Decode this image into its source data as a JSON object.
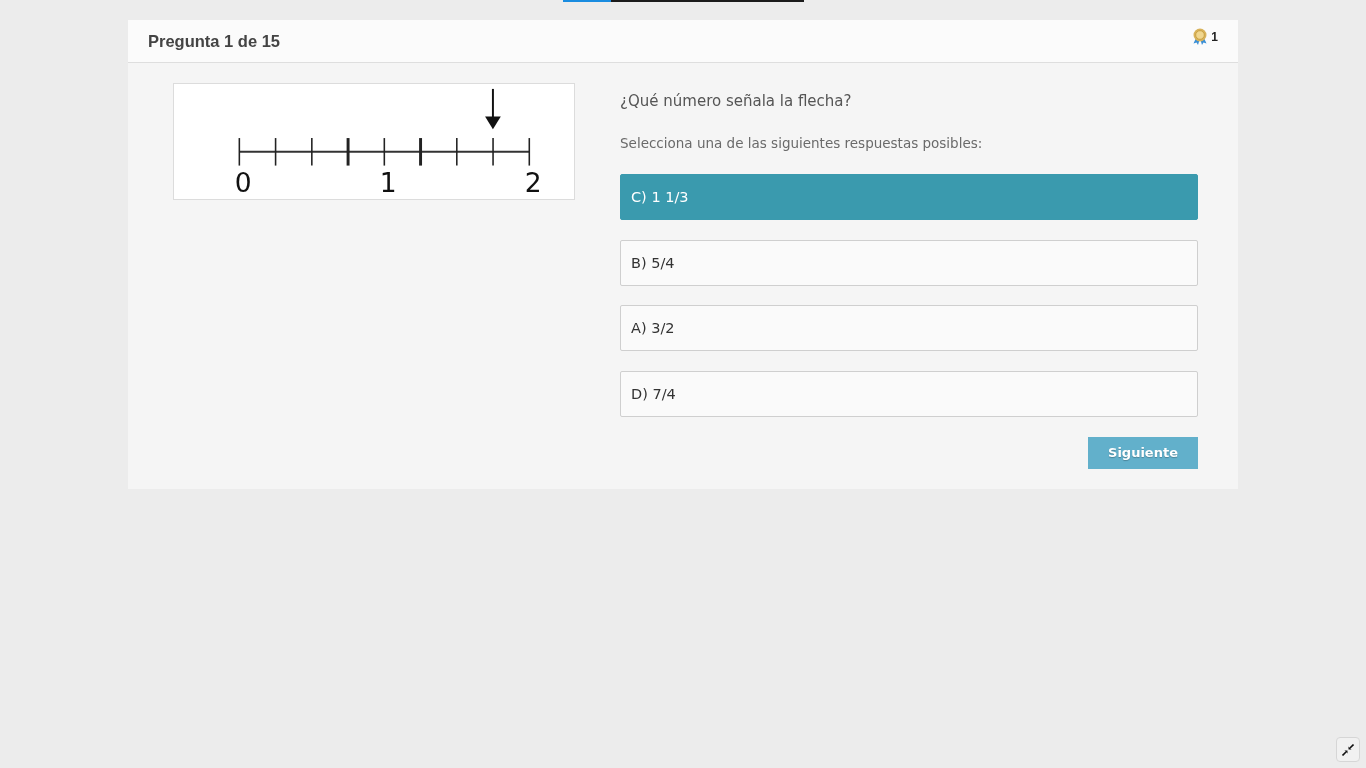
{
  "progress": {
    "level": 0.2
  },
  "header": {
    "title": "Pregunta 1 de 15",
    "points": "1"
  },
  "figure": {
    "labels": [
      "0",
      "1",
      "2"
    ]
  },
  "question": "¿Qué número señala la flecha?",
  "instruction": "Selecciona una de las siguientes respuestas posibles:",
  "options": [
    {
      "label": "C) 1 1/3",
      "selected": true
    },
    {
      "label": "B) 5/4",
      "selected": false
    },
    {
      "label": "A) 3/2",
      "selected": false
    },
    {
      "label": "D) 7/4",
      "selected": false
    }
  ],
  "next_button": "Siguiente"
}
